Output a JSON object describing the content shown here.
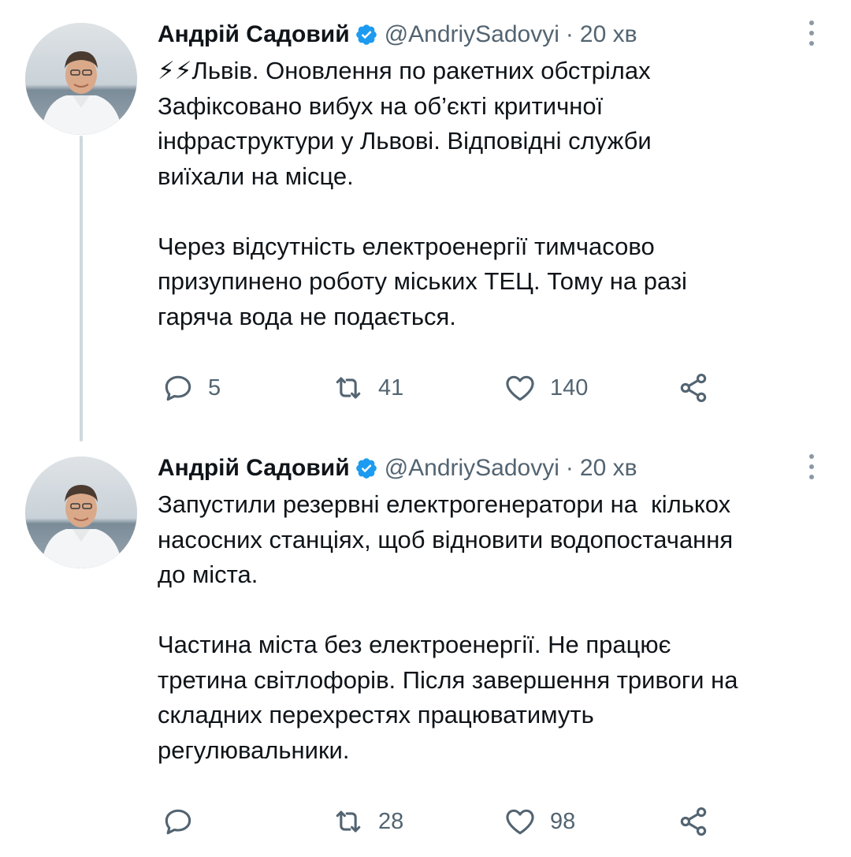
{
  "tweets": [
    {
      "author_name": "Андрій Садовий",
      "handle": "@AndriySadovyi",
      "separator": "·",
      "time": "20 хв",
      "text": "⚡⚡Львів. Оновлення по ракетних обстрілах\nЗафіксовано вибух на об’єкті критичної\nінфраструктури у Львові. Відповідні служби\nвиїхали на місце.\n\nЧерез відсутність електроенергії тимчасово\nпризупинено роботу міських ТЕЦ. Тому на разі\nгаряча вода не подається.",
      "replies": "5",
      "retweets": "41",
      "likes": "140"
    },
    {
      "author_name": "Андрій Садовий",
      "handle": "@AndriySadovyi",
      "separator": "·",
      "time": "20 хв",
      "text": "Запустили резервні електрогенератори на  кількох\nнасосних станціях, щоб відновити водопостачання\nдо міста.\n\nЧастина міста без електроенергії. Не працює\nтретина світлофорів. Після завершення тривоги на\nскладних перехрестях працюватимуть\nрегулювальники.",
      "replies": "",
      "retweets": "28",
      "likes": "98"
    }
  ],
  "colors": {
    "verified": "#1d9bf0",
    "secondary_text": "#536471",
    "thread_line": "#cfd9de"
  },
  "icons": [
    "verified-badge-icon",
    "more-options-icon",
    "reply-icon",
    "retweet-icon",
    "like-icon",
    "share-icon"
  ]
}
